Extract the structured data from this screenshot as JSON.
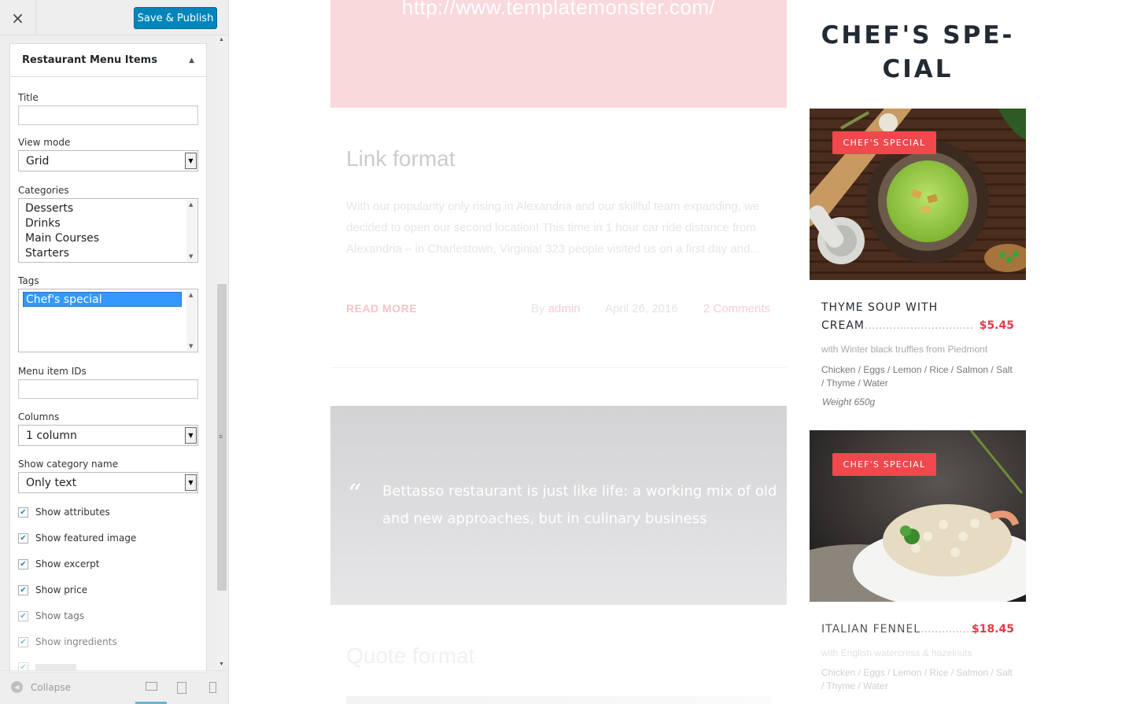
{
  "sidebar": {
    "close_icon": "×",
    "save_label": "Save & Publish",
    "panel_title": "Restaurant Menu Items",
    "fields": {
      "title_label": "Title",
      "title_value": "",
      "view_mode_label": "View mode",
      "view_mode_value": "Grid",
      "categories_label": "Categories",
      "categories": [
        "Desserts",
        "Drinks",
        "Main Courses",
        "Starters"
      ],
      "tags_label": "Tags",
      "tags": [
        "Chef's special"
      ],
      "menu_ids_label": "Menu item IDs",
      "menu_ids_value": "",
      "columns_label": "Columns",
      "columns_value": "1 column",
      "show_category_label": "Show category name",
      "show_category_value": "Only text"
    },
    "checkboxes": [
      {
        "label": "Show attributes",
        "checked": true
      },
      {
        "label": "Show featured image",
        "checked": true
      },
      {
        "label": "Show excerpt",
        "checked": true
      },
      {
        "label": "Show price",
        "checked": true
      },
      {
        "label": "Show tags",
        "checked": true
      },
      {
        "label": "Show ingredients",
        "checked": true
      }
    ],
    "footer": {
      "collapse_label": "Collapse"
    }
  },
  "preview": {
    "pink_url": "http://www.templatemonster.com/",
    "link_post": {
      "title": "Link format",
      "excerpt": "With our popularity only rising in Alexandria and our skillful team expanding, we decided to open our second location! This time in 1 hour car ride distance from Alexandria – in Charlestown, Virginia! 323 people visited us on a first day and...",
      "read_more": "READ MORE",
      "by": "By",
      "author": "admin",
      "date": "April 26, 2016",
      "comments": "2 Comments"
    },
    "quote_post": {
      "quote_mark": "“",
      "quote_text": "Bettasso restaurant is just like life: a working mix of old and new approaches, but in culinary business",
      "title": "Quote format"
    },
    "chef": {
      "heading_line1": "CHEF'S SPE-",
      "heading_line2": "CIAL",
      "items": [
        {
          "badge": "CHEF'S SPECIAL",
          "name_line1": "THYME SOUP WITH",
          "name_line2": "CREAM",
          "dots": "...............................",
          "price": "$5.45",
          "sub": "with Winter black truffles from Piedmont",
          "ingredients": "Chicken / Eggs / Lemon / Rice / Salmon / Salt / Thyme / Water",
          "weight": "Weight 650g"
        },
        {
          "badge": "CHEF'S SPECIAL",
          "name_line1": "ITALIAN FENNEL",
          "dots": "...................",
          "price": "$18.45",
          "sub": "with English watercress & hazelnuts",
          "ingredients": "Chicken / Eggs / Lemon / Rice / Salmon / Salt / Thyme / Water"
        }
      ]
    }
  }
}
